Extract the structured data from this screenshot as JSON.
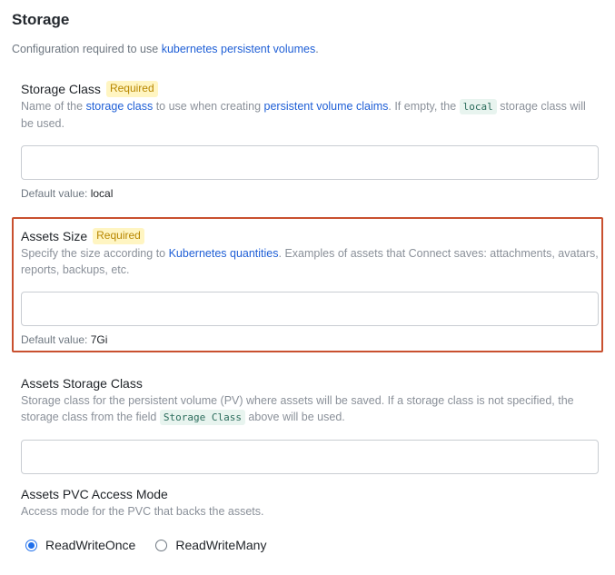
{
  "section": {
    "title": "Storage",
    "desc_prefix": "Configuration required to use ",
    "desc_link": "kubernetes persistent volumes",
    "desc_suffix": "."
  },
  "storage_class": {
    "label": "Storage Class",
    "badge": "Required",
    "desc_1": "Name of the ",
    "desc_link_1": "storage class",
    "desc_2": " to use when creating ",
    "desc_link_2": "persistent volume claims",
    "desc_3": ". If empty, the ",
    "desc_code": "local",
    "desc_4": " storage class will be used.",
    "value": "",
    "placeholder": "",
    "default_label": "Default value: ",
    "default_value": "local"
  },
  "assets_size": {
    "label": "Assets Size",
    "badge": "Required",
    "desc_1": "Specify the size according to ",
    "desc_link": "Kubernetes quantities",
    "desc_2": ". Examples of assets that Connect saves: attachments, avatars, reports, backups, etc.",
    "value": "",
    "placeholder": "",
    "default_label": "Default value: ",
    "default_value": "7Gi",
    "highlight_color": "#c9502f"
  },
  "assets_storage_class": {
    "label": "Assets Storage Class",
    "desc_1": "Storage class for the persistent volume (PV) where assets will be saved. If a storage class is not specified, the storage class from the field ",
    "desc_code": "Storage Class",
    "desc_2": " above will be used.",
    "value": "",
    "placeholder": ""
  },
  "assets_pvc_access_mode": {
    "label": "Assets PVC Access Mode",
    "desc": "Access mode for the PVC that backs the assets.",
    "options": [
      "ReadWriteOnce",
      "ReadWriteMany"
    ],
    "selected": "ReadWriteOnce"
  },
  "colors": {
    "link": "#1f5fd6",
    "badge_bg": "#fff5c2",
    "badge_text": "#b88700",
    "radio_accent": "#1f6feb"
  }
}
